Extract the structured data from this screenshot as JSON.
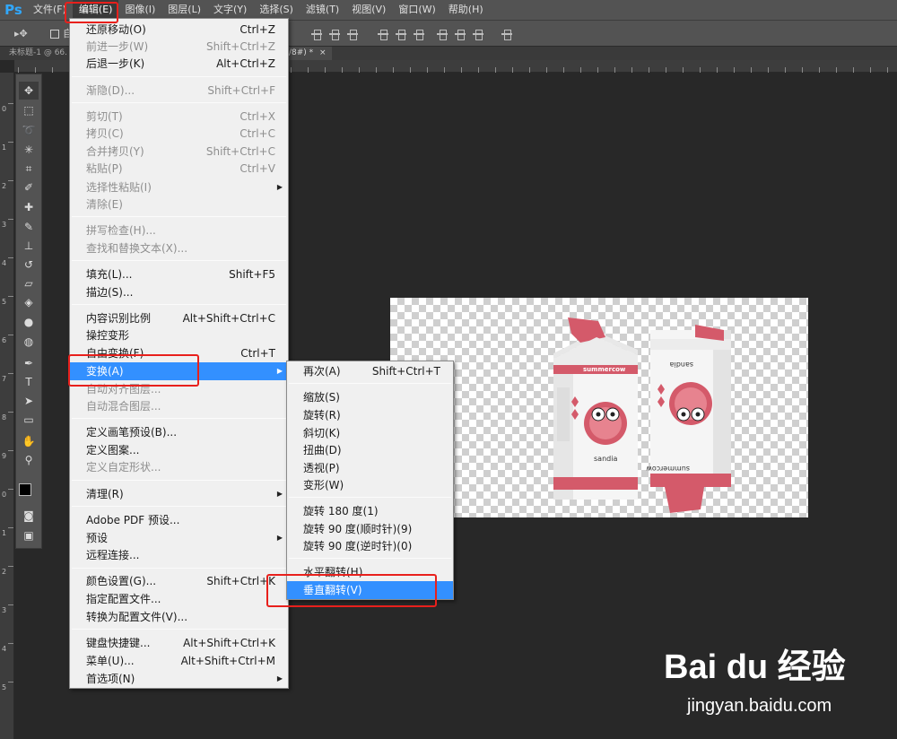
{
  "app": {
    "logo": "Ps",
    "menubar": [
      "文件(F)",
      "编辑(E)",
      "图像(I)",
      "图层(L)",
      "文字(Y)",
      "选择(S)",
      "滤镜(T)",
      "视图(V)",
      "窗口(W)",
      "帮助(H)"
    ],
    "active_menu": "编辑(E)"
  },
  "options_bar": {
    "move_tool_symbol": "▸✥",
    "auto_label": "自"
  },
  "tabs": {
    "tab1": "未标题-1 @ 66.",
    "tab2": "/8#) *",
    "tab2_close": "×"
  },
  "ruler": {
    "left_numbers": [
      "0",
      "1",
      "2",
      "3",
      "4",
      "5",
      "6",
      "7",
      "8",
      "9",
      "0",
      "1",
      "2",
      "3",
      "4",
      "5"
    ]
  },
  "edit_menu": {
    "items": [
      {
        "label": "还原移动(O)",
        "shortcut": "Ctrl+Z",
        "disabled": false
      },
      {
        "label": "前进一步(W)",
        "shortcut": "Shift+Ctrl+Z",
        "disabled": true
      },
      {
        "label": "后退一步(K)",
        "shortcut": "Alt+Ctrl+Z",
        "disabled": false
      },
      {
        "label": "渐隐(D)...",
        "shortcut": "Shift+Ctrl+F",
        "disabled": true
      },
      {
        "label": "剪切(T)",
        "shortcut": "Ctrl+X",
        "disabled": true
      },
      {
        "label": "拷贝(C)",
        "shortcut": "Ctrl+C",
        "disabled": true
      },
      {
        "label": "合并拷贝(Y)",
        "shortcut": "Shift+Ctrl+C",
        "disabled": true
      },
      {
        "label": "粘贴(P)",
        "shortcut": "Ctrl+V",
        "disabled": true
      },
      {
        "label": "选择性粘贴(I)",
        "shortcut": "",
        "disabled": true,
        "submenu": true
      },
      {
        "label": "清除(E)",
        "shortcut": "",
        "disabled": true
      },
      {
        "label": "拼写检查(H)...",
        "shortcut": "",
        "disabled": true
      },
      {
        "label": "查找和替换文本(X)...",
        "shortcut": "",
        "disabled": true
      },
      {
        "label": "填充(L)...",
        "shortcut": "Shift+F5",
        "disabled": false
      },
      {
        "label": "描边(S)...",
        "shortcut": "",
        "disabled": false
      },
      {
        "label": "内容识别比例",
        "shortcut": "Alt+Shift+Ctrl+C",
        "disabled": false
      },
      {
        "label": "操控变形",
        "shortcut": "",
        "disabled": false
      },
      {
        "label": "自由变换(F)",
        "shortcut": "Ctrl+T",
        "disabled": false
      },
      {
        "label": "变换(A)",
        "shortcut": "",
        "disabled": false,
        "submenu": true,
        "highlighted": true
      },
      {
        "label": "自动对齐图层...",
        "shortcut": "",
        "disabled": true
      },
      {
        "label": "自动混合图层...",
        "shortcut": "",
        "disabled": true
      },
      {
        "label": "定义画笔预设(B)...",
        "shortcut": "",
        "disabled": false
      },
      {
        "label": "定义图案...",
        "shortcut": "",
        "disabled": false
      },
      {
        "label": "定义自定形状...",
        "shortcut": "",
        "disabled": true
      },
      {
        "label": "清理(R)",
        "shortcut": "",
        "disabled": false,
        "submenu": true
      },
      {
        "label": "Adobe PDF 预设...",
        "shortcut": "",
        "disabled": false
      },
      {
        "label": "预设",
        "shortcut": "",
        "disabled": false,
        "submenu": true
      },
      {
        "label": "远程连接...",
        "shortcut": "",
        "disabled": false
      },
      {
        "label": "颜色设置(G)...",
        "shortcut": "Shift+Ctrl+K",
        "disabled": false
      },
      {
        "label": "指定配置文件...",
        "shortcut": "",
        "disabled": false
      },
      {
        "label": "转换为配置文件(V)...",
        "shortcut": "",
        "disabled": false
      },
      {
        "label": "键盘快捷键...",
        "shortcut": "Alt+Shift+Ctrl+K",
        "disabled": false
      },
      {
        "label": "菜单(U)...",
        "shortcut": "Alt+Shift+Ctrl+M",
        "disabled": false
      },
      {
        "label": "首选项(N)",
        "shortcut": "",
        "disabled": false,
        "submenu": true
      }
    ]
  },
  "transform_menu": {
    "items": [
      {
        "label": "再次(A)",
        "shortcut": "Shift+Ctrl+T"
      },
      {
        "label": "缩放(S)",
        "shortcut": ""
      },
      {
        "label": "旋转(R)",
        "shortcut": ""
      },
      {
        "label": "斜切(K)",
        "shortcut": ""
      },
      {
        "label": "扭曲(D)",
        "shortcut": ""
      },
      {
        "label": "透视(P)",
        "shortcut": ""
      },
      {
        "label": "变形(W)",
        "shortcut": ""
      },
      {
        "label": "旋转 180 度(1)",
        "shortcut": ""
      },
      {
        "label": "旋转 90 度(顺时针)(9)",
        "shortcut": ""
      },
      {
        "label": "旋转 90 度(逆时针)(0)",
        "shortcut": ""
      },
      {
        "label": "水平翻转(H)",
        "shortcut": ""
      },
      {
        "label": "垂直翻转(V)",
        "shortcut": "",
        "highlighted": true
      }
    ]
  },
  "canvas_artwork": {
    "carton_brand": "summercow",
    "carton_flavor": "sandia",
    "carton_flipped_brand": "summercow",
    "carton_flipped_flavor": "sandia",
    "accent_color": "#d45a6a"
  },
  "watermark": {
    "logo": "Bai du 经验",
    "url": "jingyan.baidu.com"
  },
  "colors": {
    "highlight": "#3390ff",
    "annotation_red": "#e8201c"
  }
}
